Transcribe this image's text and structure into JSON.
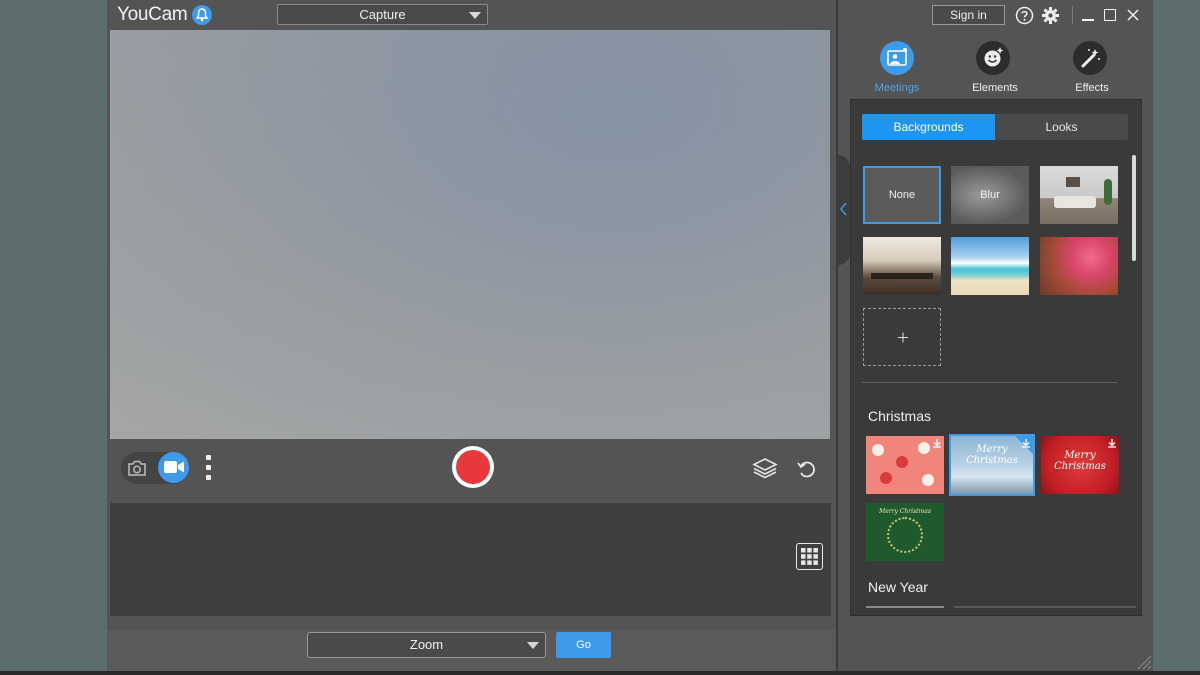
{
  "app": {
    "logo": "YouCam",
    "mode_select": {
      "value": "Capture"
    }
  },
  "toolbar": {
    "zoom_select": {
      "value": "Zoom"
    },
    "go_label": "Go"
  },
  "right_panel": {
    "signin_label": "Sign in",
    "tabs": [
      {
        "label": "Meetings",
        "icon": "meetings-icon",
        "active": true
      },
      {
        "label": "Elements",
        "icon": "smiley-sticker-icon",
        "active": false
      },
      {
        "label": "Effects",
        "icon": "magic-wand-icon",
        "active": false
      }
    ],
    "segments": {
      "backgrounds": "Backgrounds",
      "looks": "Looks"
    },
    "thumbs": {
      "none": "None",
      "blur": "Blur"
    },
    "sections": [
      {
        "title": "Christmas"
      },
      {
        "title": "New Year"
      }
    ],
    "christmas_texts": {
      "merry_christmas": "Merry Christmas",
      "merry_christmas_red": "Merry Christmas",
      "merry_christmas_green": "Merry Christmas"
    }
  },
  "colors": {
    "accent": "#3d9be9",
    "record": "#e8383d",
    "panel_bg": "#545454",
    "panel_inner": "#3a3a3a"
  }
}
